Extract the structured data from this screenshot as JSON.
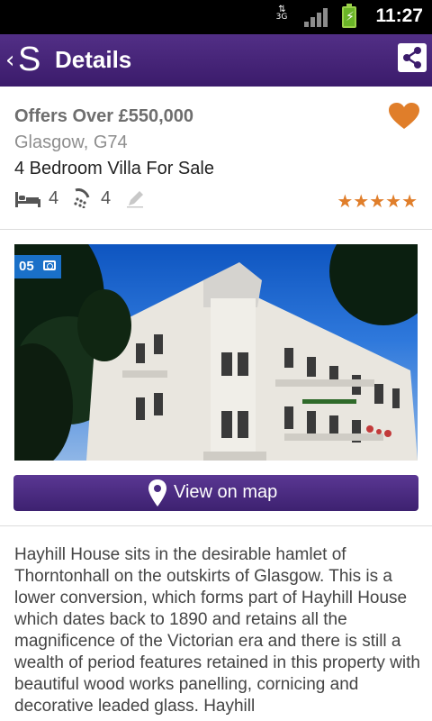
{
  "status_bar": {
    "network": "3G",
    "time": "11:27"
  },
  "header": {
    "title": "Details",
    "back_icon": "back-logo-icon",
    "share_icon": "share-icon"
  },
  "listing": {
    "price": "Offers Over £550,000",
    "location": "Glasgow, G74",
    "property_type": "4 Bedroom Villa For Sale",
    "bedrooms": "4",
    "bathrooms": "4",
    "rating": 5,
    "rating_stars": "★★★★★",
    "favorited": true,
    "photo_count": "05",
    "map_button_label": "View on map",
    "description": "Hayhill House sits in the desirable hamlet of Thorntonhall on the outskirts of Glasgow. This is a lower conversion, which forms part of Hayhill House which dates back to 1890 and retains all the magnificence of the Victorian era and there is still a wealth of period features retained in this property with beautiful wood works panelling, cornicing and decorative leaded glass. Hayhill"
  },
  "colors": {
    "app_bar": "#3b1b6b",
    "accent_orange": "#e07e2a",
    "photo_badge": "#1a70c8"
  }
}
